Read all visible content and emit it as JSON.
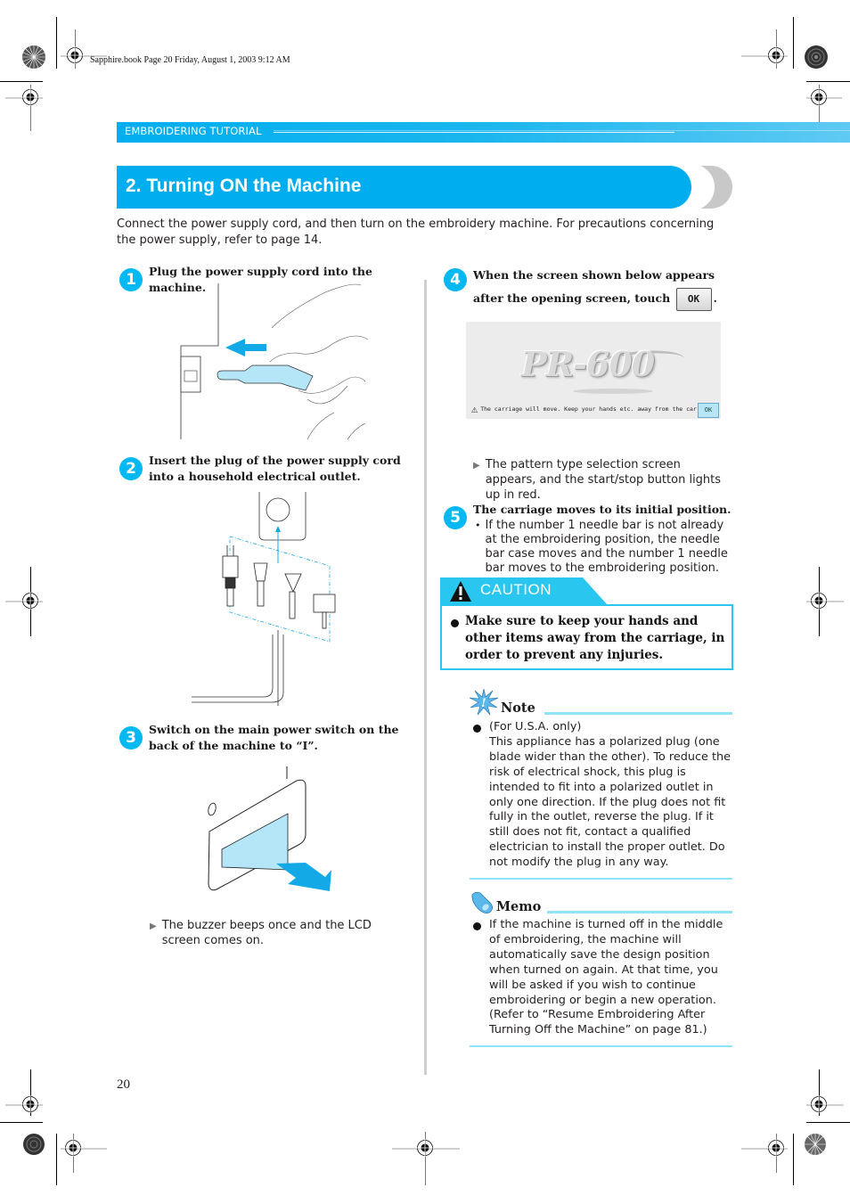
{
  "print_slug": "Sapphire.book  Page 20  Friday, August 1, 2003  9:12 AM",
  "section_header": "EMBROIDERING TUTORIAL",
  "title": "2. Turning ON the Machine",
  "intro": "Connect the power supply cord, and then turn on the embroidery machine. For precautions concerning the power supply, refer to page 14.",
  "steps": [
    {
      "number": "1",
      "heading": "Plug the power supply cord into the machine.",
      "illustration": "plug-into-machine"
    },
    {
      "number": "2",
      "heading": "Insert the plug of the power supply cord into a household electrical outlet.",
      "illustration": "household-plug-types"
    },
    {
      "number": "3",
      "heading": "Switch on the main power switch on the back of the machine to “I”.",
      "illustration": "power-switch",
      "switch_labels": {
        "off": "O",
        "on": "I"
      },
      "result": "The buzzer beeps once and the LCD screen comes on."
    },
    {
      "number": "4",
      "heading_before": "When the screen shown below appears after the opening screen, touch",
      "heading_after": ".",
      "button_label": "OK",
      "lcd": {
        "logo": "PR-600",
        "message": "The carriage will move. Keep your hands etc. away from the carriage.",
        "ok_label": "OK"
      },
      "result": "The pattern type selection screen appears, and the start/stop button lights up in red."
    },
    {
      "number": "5",
      "heading": "The carriage moves to its initial position.",
      "bullet": "If the number 1 needle bar is not already at the embroidering position, the needle bar case moves and the number 1 needle bar moves to the embroidering position."
    }
  ],
  "caution": {
    "label": "CAUTION",
    "text": "Make sure to keep your hands and other items away from the carriage, in order to prevent any injuries."
  },
  "note": {
    "title": "Note",
    "lead": "(For U.S.A. only)",
    "text": "This appliance has a polarized plug (one blade wider than the other). To reduce the risk of electrical shock, this plug is intended to fit into a polarized outlet in only one direction. If the plug does not fit fully in the outlet, reverse the plug. If it still does not fit, contact a qualified electrician to install the proper outlet. Do not modify the plug in any way."
  },
  "memo": {
    "title": "Memo",
    "text": "If the machine is turned off in the middle of embroidering, the machine will automatically save the design position when turned on again. At that time, you will be asked if you wish to continue embroidering or begin a new operation. (Refer to “Resume Embroidering After Turning Off the Machine” on page 81.)"
  },
  "page_number": "20",
  "colors": {
    "accent": "#00aeef",
    "step_badge": "#00b9f2",
    "caution_border": "#29c7ef",
    "rule": "#8fe3f5",
    "illustration_fill": "#b4e6f8"
  }
}
